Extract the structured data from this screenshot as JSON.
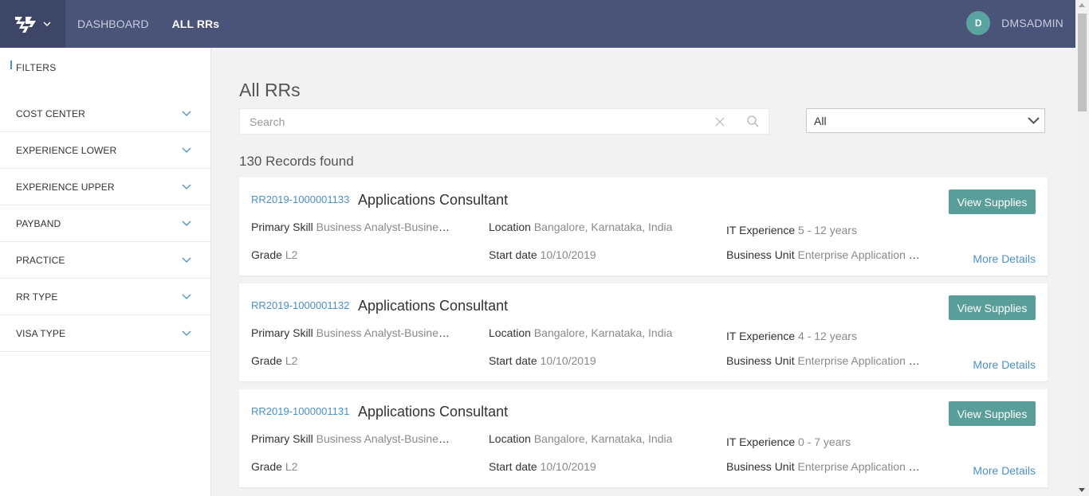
{
  "nav": {
    "dashboard": "DASHBOARD",
    "all_rrs": "ALL RRs"
  },
  "user": {
    "initial": "D",
    "name": "DMSADMIN"
  },
  "sidebar": {
    "title": "FILTERS",
    "filters": [
      {
        "label": "COST CENTER"
      },
      {
        "label": "EXPERIENCE LOWER"
      },
      {
        "label": "EXPERIENCE UPPER"
      },
      {
        "label": "PAYBAND"
      },
      {
        "label": "PRACTICE"
      },
      {
        "label": "RR TYPE"
      },
      {
        "label": "VISA TYPE"
      }
    ]
  },
  "main": {
    "title": "All RRs",
    "search_placeholder": "Search",
    "select_value": "All",
    "records": "130 Records found"
  },
  "labels": {
    "primary_skill": "Primary Skill",
    "location": "Location",
    "it_experience": "IT Experience",
    "grade": "Grade",
    "start_date": "Start date",
    "business_unit": "Business Unit",
    "view_supplies": "View Supplies",
    "more_details": "More Details"
  },
  "cards": [
    {
      "id": "RR2019-1000001133",
      "role": "Applications Consultant",
      "primary_skill": "Business Analyst-Business Analysis",
      "location": "Bangalore, Karnataka, India",
      "it_experience": "5 - 12 years",
      "grade": "L2",
      "start_date": "10/10/2019",
      "business_unit": "Enterprise Application Services"
    },
    {
      "id": "RR2019-1000001132",
      "role": "Applications Consultant",
      "primary_skill": "Business Analyst-Business Analysis",
      "location": "Bangalore, Karnataka, India",
      "it_experience": "4 - 12 years",
      "grade": "L2",
      "start_date": "10/10/2019",
      "business_unit": "Enterprise Application Services"
    },
    {
      "id": "RR2019-1000001131",
      "role": "Applications Consultant",
      "primary_skill": "Business Analyst-Business Analysis",
      "location": "Bangalore, Karnataka, India",
      "it_experience": "0 - 7 years",
      "grade": "L2",
      "start_date": "10/10/2019",
      "business_unit": "Enterprise Application Services"
    }
  ],
  "colors": {
    "topbar": "#4a5478",
    "accent": "#5a9e99",
    "link": "#4a90c8"
  }
}
